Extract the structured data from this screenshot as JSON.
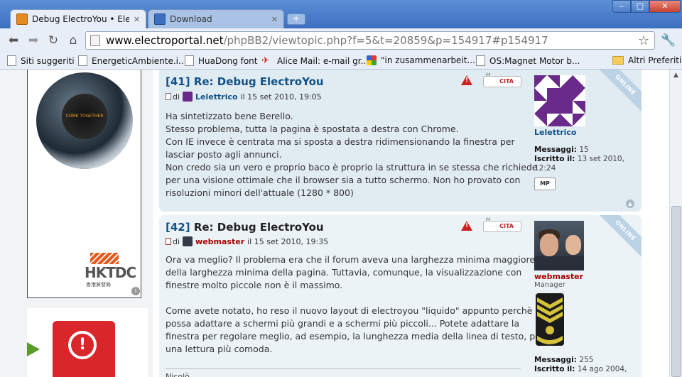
{
  "browser": {
    "tabs": [
      {
        "title": "Debug ElectroYou • Elect...",
        "favicon": "electroyou-favicon",
        "active": true
      },
      {
        "title": "Download",
        "favicon": "download-favicon",
        "active": false
      }
    ],
    "new_tab": "+",
    "window_buttons": {
      "minimize": "–",
      "maximize": "□",
      "close": "✕"
    },
    "url_host": "www.electroportal.net",
    "url_path": "/phpBB2/viewtopic.php?f=5&t=20859&p=154917#p154917",
    "bookmarks": [
      {
        "label": "Siti suggeriti",
        "icon": "page-icon"
      },
      {
        "label": "EnergeticAmbiente.i...",
        "icon": "page-icon"
      },
      {
        "label": "HuaDong font",
        "icon": "page-icon"
      },
      {
        "label": "Alice Mail: e-mail gr...",
        "icon": "alice-icon"
      },
      {
        "label": "\"in zusammenarbeit...",
        "icon": "google-icon"
      },
      {
        "label": "OS:Magnet Motor b...",
        "icon": "page-icon"
      },
      {
        "label": "Altri Preferiti",
        "icon": "folder-icon"
      }
    ]
  },
  "ads": {
    "ad1_globe_text": "COME TOGETHER",
    "ad1_brand": "HKTDC",
    "ad1_brand_sub": "香港貿發局",
    "ad_info": "i",
    "ad2_symbol": "!"
  },
  "posts": [
    {
      "number": "[41]",
      "subject": "Re: Debug ElectroYou",
      "di": "di",
      "author": "Lelettrico",
      "date": "il 15 set 2010, 19:05",
      "quote_label": "CITA",
      "body": [
        "Ha sintetizzato bene Berello.",
        "Stesso problema, tutta la pagina è spostata a destra con Chrome.",
        "Con IE invece è centrata ma si sposta a destra ridimensionando la finestra per",
        "lasciar posto agli annunci.",
        "Non credo sia un vero e proprio baco è proprio la struttura in se stessa che richiede",
        "per una visione ottimale che il browser sia a tutto schermo. Non ho provato con",
        "risoluzioni minori dell'attuale (1280 * 800)"
      ],
      "profile": {
        "name": "Lelettrico",
        "messages_label": "Messaggi:",
        "messages": "15",
        "joined_label": "Iscritto il:",
        "joined": "13 set 2010,",
        "joined_time": "12:24",
        "pm_label": "MP"
      },
      "online_label": "ONLINE"
    },
    {
      "number": "[42]",
      "subject": "Re: Debug ElectroYou",
      "di": "di",
      "author": "webmaster",
      "date": "il 15 set 2010, 19:35",
      "quote_label": "CITA",
      "body": [
        "Ora va meglio? Il problema era che il forum aveva una larghezza minima maggiore",
        "della larghezza minima della pagina. Tuttavia, comunque, la visualizzazione con",
        "finestre molto piccole non è il massimo.",
        "",
        "Come avete notato, ho reso il nuovo layout di electroyou \"liquido\" appunto perchè si",
        "possa adattare a schermi più grandi e a schermi più piccoli... Potete adattare la",
        "finestra per regolare meglio, ad esempio, la lunghezza media della linea di testo, per",
        "una lettura più comoda."
      ],
      "signature": "Nicolò",
      "profile": {
        "name": "webmaster",
        "rank": "Manager",
        "messages_label": "Messaggi:",
        "messages": "255",
        "joined_label": "Iscritto il:",
        "joined": "14 ago 2004,"
      },
      "online_label": "ONLINE"
    }
  ],
  "colors": {
    "post_bg_1": "#e1ebf2",
    "post_bg_2": "#ecf3f7",
    "link_blue": "#105289",
    "admin_red": "#aa0000",
    "avatar_purple": "#6a2a8a"
  }
}
